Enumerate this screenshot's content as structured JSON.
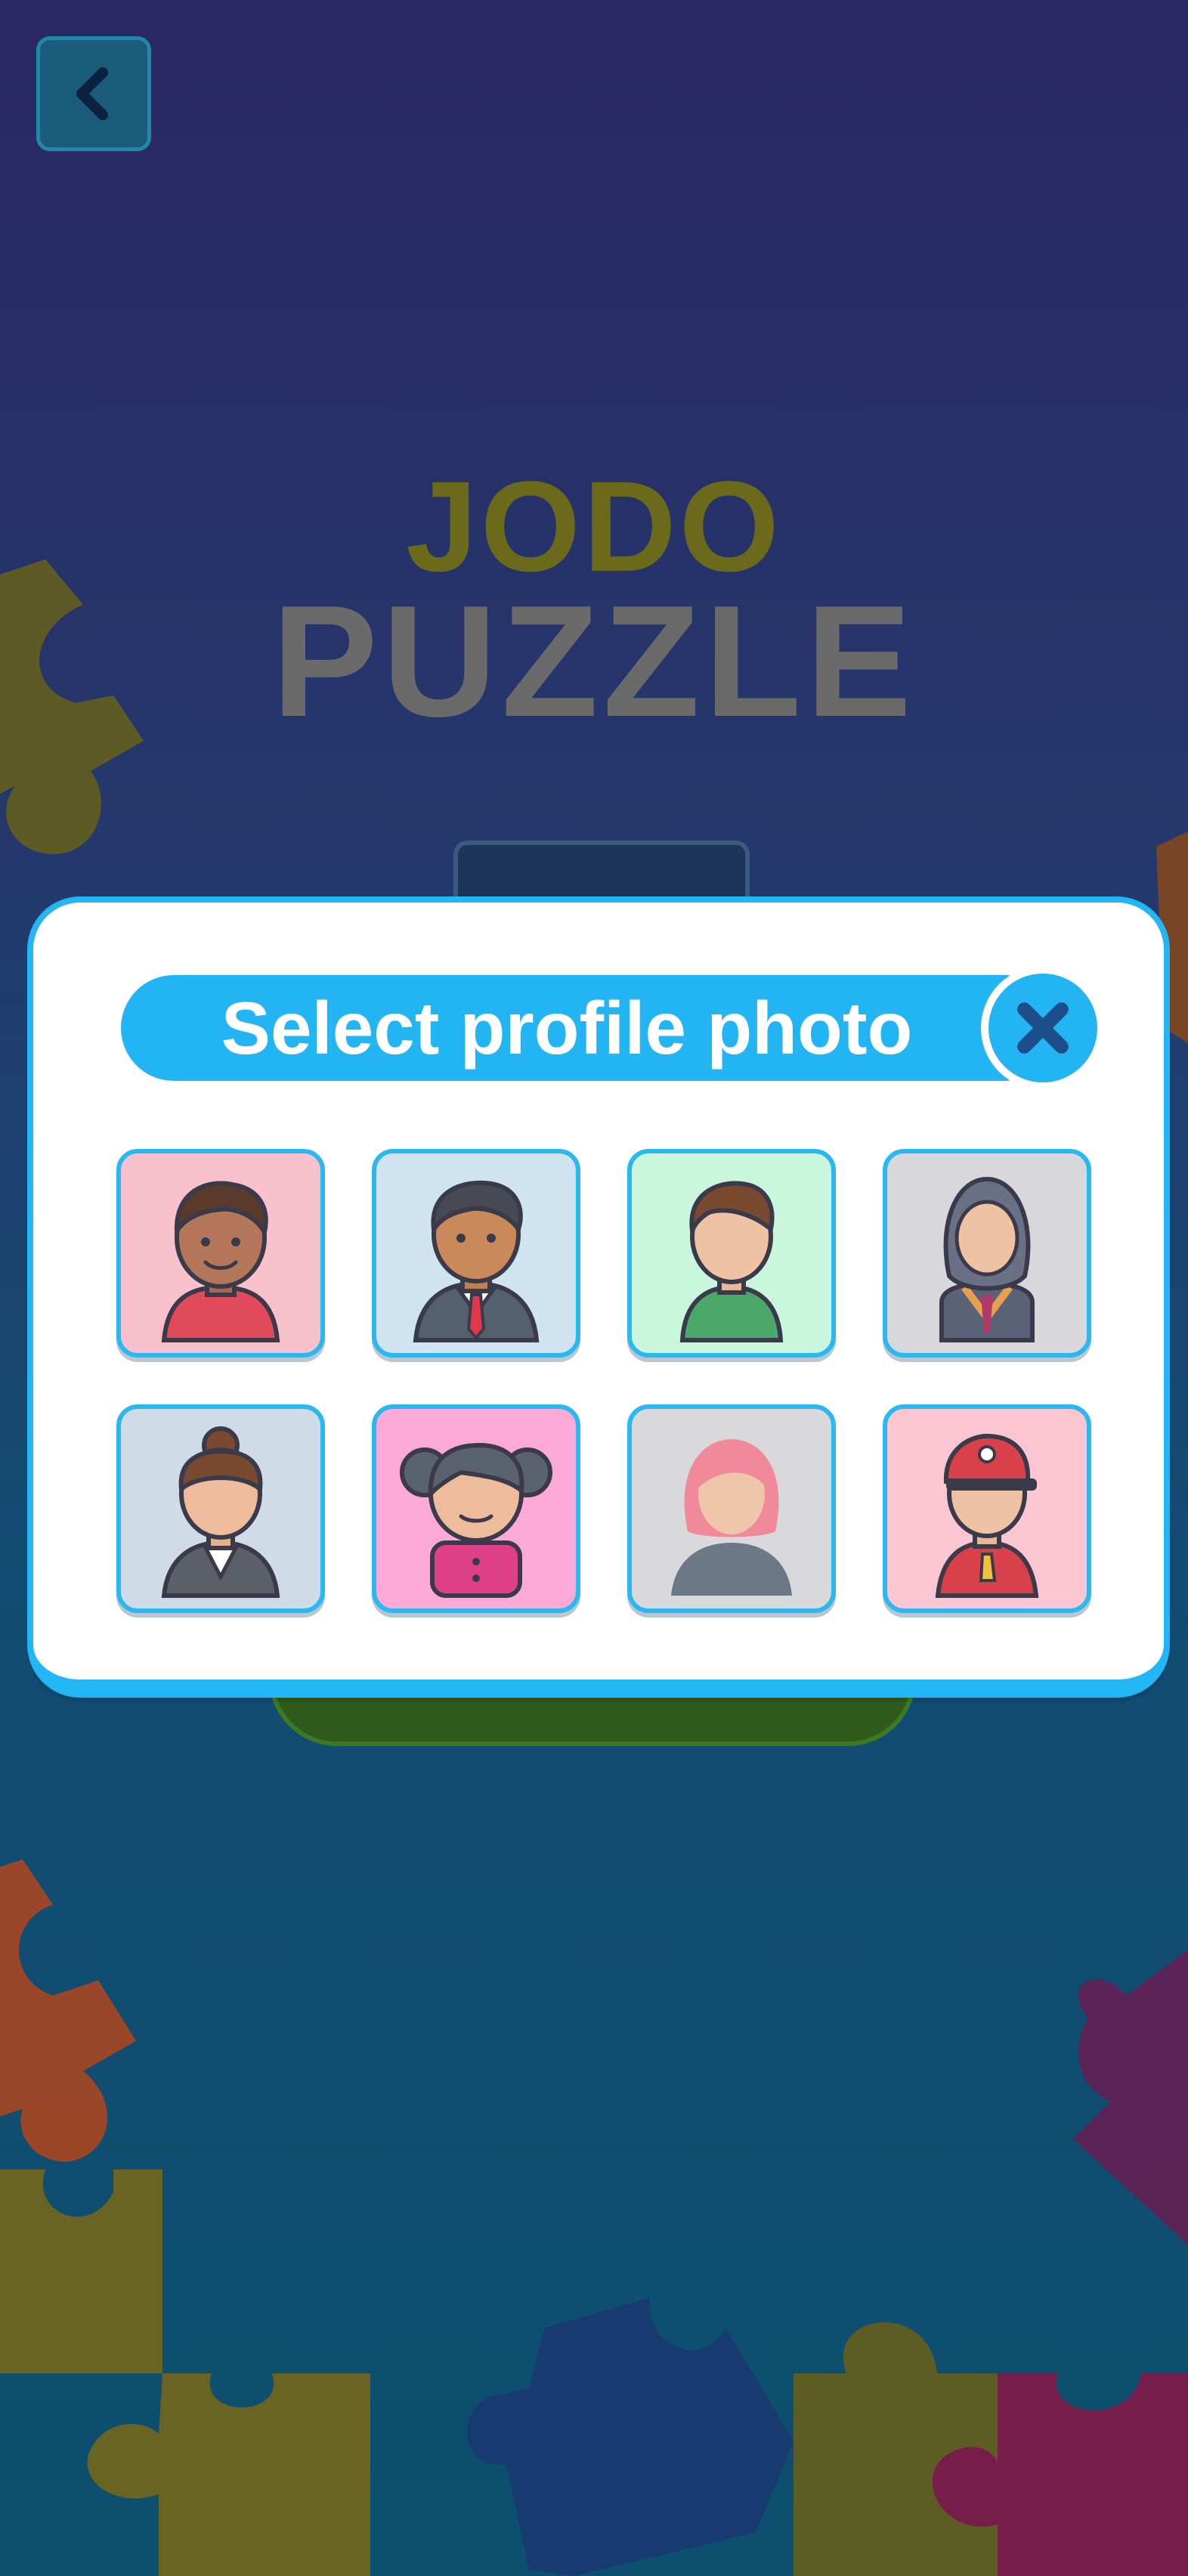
{
  "app": {
    "logo_line1": "JODO",
    "logo_line2": "PUZZLE"
  },
  "icons": {
    "back": "chevron-left-icon",
    "close": "close-icon"
  },
  "modal": {
    "title": "Select profile photo",
    "avatars": [
      {
        "name": "avatar-boy-curly",
        "bg": "#f9c1cb"
      },
      {
        "name": "avatar-businessman",
        "bg": "#cfe3f1"
      },
      {
        "name": "avatar-young-man",
        "bg": "#c9f6dd"
      },
      {
        "name": "avatar-hijab-woman",
        "bg": "#d7d7dc"
      },
      {
        "name": "avatar-businesswoman",
        "bg": "#cfdbe6"
      },
      {
        "name": "avatar-girl-pigtails",
        "bg": "#fba9d6"
      },
      {
        "name": "avatar-pink-haired-woman",
        "bg": "#d9d9dc"
      },
      {
        "name": "avatar-referee-cap",
        "bg": "#fbc6d2"
      }
    ]
  },
  "colors": {
    "accent": "#23b4f4",
    "modal_bg": "#ffffff",
    "close_x": "#1f4f8a"
  }
}
